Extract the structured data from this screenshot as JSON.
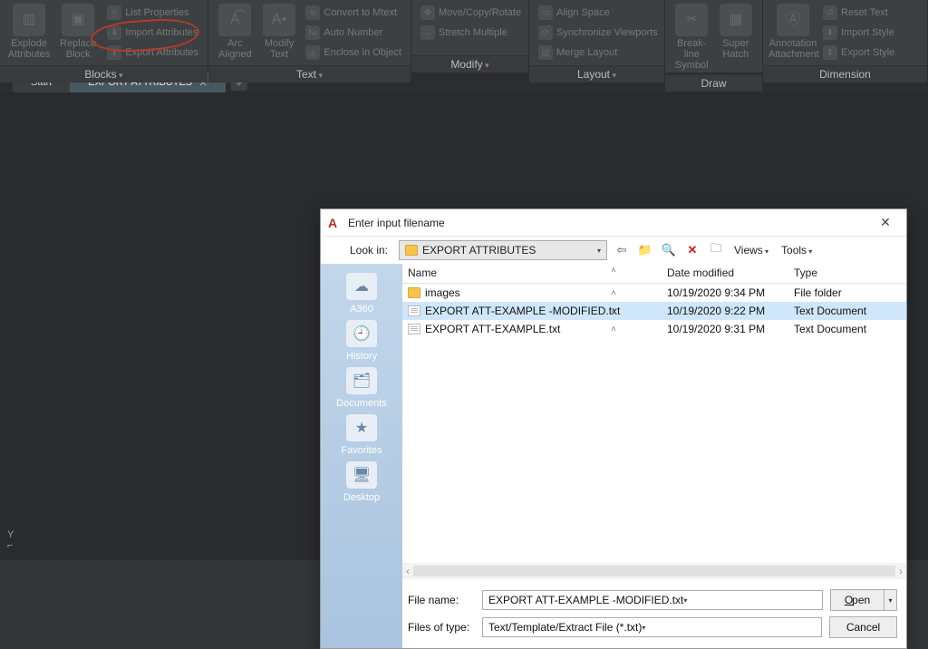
{
  "ribbon": {
    "blocks": {
      "label": "Blocks",
      "explode": "Explode\nAttributes",
      "replace": "Replace\nBlock",
      "list_props": "List Properties",
      "import_attr": "Import Attributes",
      "export_attr": "Export Attributes"
    },
    "text": {
      "label": "Text",
      "arc": "Arc\nAligned",
      "modify": "Modify\nText",
      "convert": "Convert to Mtext",
      "auton": "Auto Number",
      "enclose": "Enclose in Object"
    },
    "modify": {
      "label": "Modify",
      "move": "Move/Copy/Rotate",
      "stretch": "Stretch Multiple"
    },
    "layout": {
      "label": "Layout",
      "align": "Align Space",
      "sync": "Synchronize Viewports",
      "merge": "Merge Layout"
    },
    "draw": {
      "label": "Draw",
      "break": "Break-line\nSymbol",
      "super": "Super\nHatch"
    },
    "dim": {
      "label": "Dimension",
      "annot": "Annotation\nAttachment",
      "reset": "Reset Text",
      "imps": "Import Style",
      "exps": "Export Style"
    }
  },
  "tabs": {
    "start": "Start",
    "doc": "EXPORT ATTRIBUTES*"
  },
  "dialog": {
    "title": "Enter input filename",
    "lookin_label": "Look in:",
    "lookin_value": "EXPORT ATTRIBUTES",
    "views": "Views",
    "tools": "Tools",
    "cols": {
      "name": "Name",
      "date": "Date modified",
      "type": "Type"
    },
    "rows": [
      {
        "icon": "folder",
        "name": "images",
        "date": "10/19/2020 9:34 PM",
        "type": "File folder",
        "sel": false
      },
      {
        "icon": "txt",
        "name": "EXPORT ATT-EXAMPLE -MODIFIED.txt",
        "date": "10/19/2020 9:22 PM",
        "type": "Text Document",
        "sel": true
      },
      {
        "icon": "txt",
        "name": "EXPORT ATT-EXAMPLE.txt",
        "date": "10/19/2020 9:31 PM",
        "type": "Text Document",
        "sel": false
      }
    ],
    "places": [
      "A360",
      "History",
      "Documents",
      "Favorites",
      "Desktop"
    ],
    "file_label": "File name:",
    "file_value": "EXPORT ATT-EXAMPLE -MODIFIED.txt",
    "type_label": "Files of type:",
    "type_value": "Text/Template/Extract File (*.txt)",
    "open": "Open",
    "cancel": "Cancel"
  },
  "ucs": {
    "y": "Y"
  }
}
